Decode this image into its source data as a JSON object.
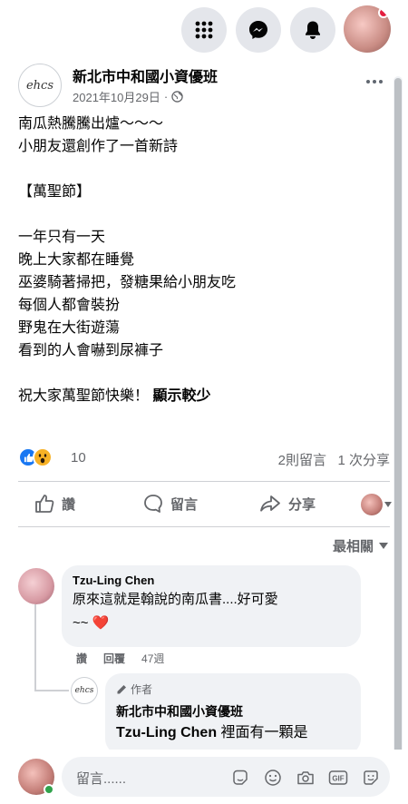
{
  "post": {
    "page_name": "新北市中和國小資優班",
    "page_logo_text": "ehcs",
    "date": "2021年10月29日",
    "lines": [
      "南瓜熱騰騰出爐～～～",
      "小朋友還創作了一首新詩",
      "",
      "【萬聖節】",
      "",
      "一年只有一天",
      "晚上大家都在睡覺",
      "巫婆騎著掃把，發糖果給小朋友吃",
      "每個人都會裝扮",
      "野鬼在大街遊蕩",
      "看到的人會嚇到尿褲子",
      "",
      "祝大家萬聖節快樂！"
    ],
    "see_more": "顯示較少"
  },
  "reactions": {
    "count": "10",
    "comments": "2則留言",
    "shares": "1 次分享"
  },
  "actions": {
    "like": "讚",
    "comment": "留言",
    "share": "分享"
  },
  "sort": {
    "label": "最相關"
  },
  "comments": [
    {
      "name": "Tzu-Ling Chen",
      "text_line1": "原來這就是翰說的南瓜書....好可愛",
      "text_line2": "~~ ❤️",
      "like": "讚",
      "reply": "回覆",
      "time": "47週"
    }
  ],
  "reply": {
    "badge": "作者",
    "name": "新北市中和國小資優班",
    "mention": "Tzu-Ling Chen",
    "text": "裡面有一顆是"
  },
  "composer": {
    "placeholder": "留言......"
  },
  "colors": {
    "accent": "#1877f2",
    "muted": "#65676b",
    "bubble": "#f0f2f5",
    "notification": "#e41e3f",
    "online": "#31a24c"
  }
}
